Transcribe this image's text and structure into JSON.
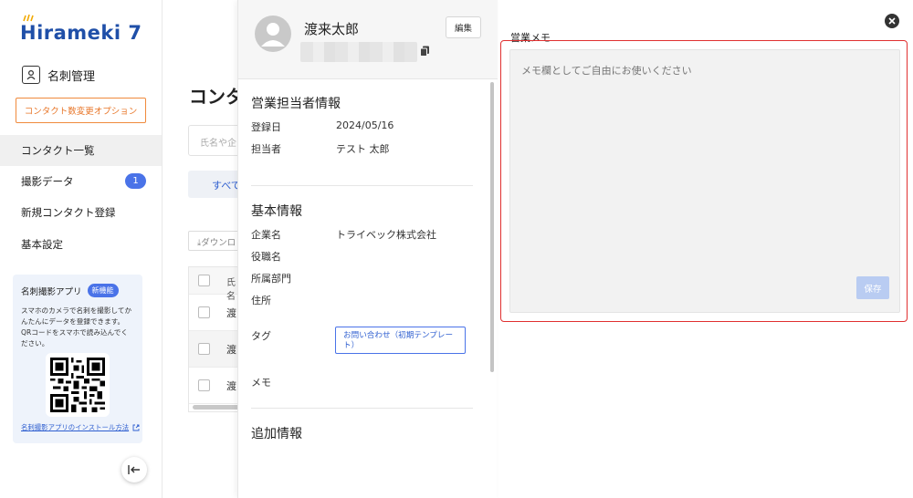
{
  "sidebar": {
    "logo": "Hirameki 7",
    "module": "名刺管理",
    "option_button": "コンタクト数変更オプション",
    "nav": [
      {
        "label": "コンタクト一覧"
      },
      {
        "label": "撮影データ",
        "badge": "1"
      },
      {
        "label": "新規コンタクト登録"
      },
      {
        "label": "基本設定"
      }
    ],
    "app_card": {
      "title": "名刺撮影アプリ",
      "badge": "新機能",
      "description": "スマホのカメラで名刺を撮影してかんたんにデータを登録できます。QRコードをスマホで読み込んでください。",
      "link": "名刺撮影アプリのインストール方法"
    }
  },
  "background": {
    "title": "コンタ",
    "search_placeholder": "氏名や企",
    "filter_all": "すべて",
    "download": "ダウンロ",
    "table_header": "氏名",
    "rows": [
      "渡",
      "渡",
      "渡"
    ]
  },
  "panel": {
    "name": "渡来太郎",
    "edit_button": "編集",
    "sales_section": {
      "title": "営業担当者情報",
      "fields": [
        {
          "label": "登録日",
          "value": "2024/05/16"
        },
        {
          "label": "担当者",
          "value": "テスト 太郎"
        }
      ]
    },
    "basic_section": {
      "title": "基本情報",
      "fields": [
        {
          "label": "企業名",
          "value": "トライベック株式会社"
        },
        {
          "label": "役職名",
          "value": ""
        },
        {
          "label": "所属部門",
          "value": ""
        },
        {
          "label": "住所",
          "value": ""
        }
      ],
      "tag_label": "タグ",
      "tag_value": "お問い合わせ（初期テンプレート）",
      "memo_label": "メモ"
    },
    "extra_section": {
      "title": "追加情報"
    }
  },
  "memo": {
    "label": "営業メモ",
    "placeholder": "メモ欄としてご自由にお使いください",
    "save_button": "保存"
  },
  "colors": {
    "accent": "#4a73e8",
    "brand": "#1f4fa8",
    "option_orange": "#e8772a",
    "highlight_border": "#e03030",
    "save_disabled": "#b9ccf2"
  },
  "icons": {
    "module": "business-card-icon",
    "copy": "copy-icon",
    "close": "close-circle-icon",
    "collapse": "collapse-left-icon",
    "external": "external-link-icon",
    "download": "download-icon"
  }
}
